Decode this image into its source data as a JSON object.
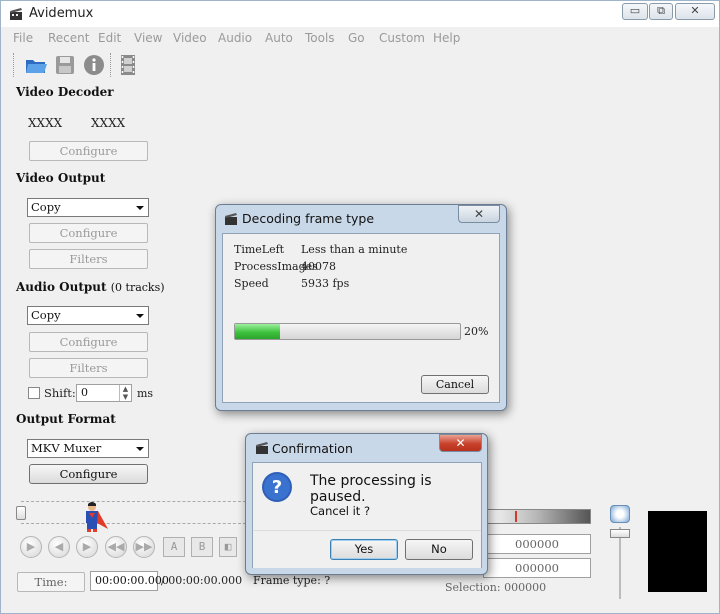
{
  "window": {
    "title": "Avidemux",
    "min_glyph": "▭",
    "max_glyph": "⧉",
    "close_glyph": "✕"
  },
  "menu": [
    "File",
    "Recent",
    "Edit",
    "View",
    "Video",
    "Audio",
    "Auto",
    "Tools",
    "Go",
    "Custom",
    "Help"
  ],
  "toolbar_icons": [
    "open-folder-icon",
    "save-disk-icon",
    "info-icon",
    "filmstrip-icon"
  ],
  "video_decoder": {
    "title": "Video Decoder",
    "codec_a": "XXXX",
    "codec_b": "XXXX",
    "configure_label": "Configure"
  },
  "video_output": {
    "title": "Video Output",
    "selected": "Copy",
    "configure_label": "Configure",
    "filters_label": "Filters"
  },
  "audio_output": {
    "title": "Audio Output",
    "tracks_note": "(0 tracks)",
    "selected": "Copy",
    "configure_label": "Configure",
    "filters_label": "Filters",
    "shift_label": "Shift:",
    "shift_value": "0",
    "shift_unit": "ms"
  },
  "output_format": {
    "title": "Output Format",
    "selected": "MKV Muxer",
    "configure_label": "Configure"
  },
  "bottom": {
    "time_label": "Time:",
    "time_value": "00:00:00.000",
    "duration": "/ 00:00:00.000",
    "frame_type": "Frame type:  ?",
    "selection": "Selection: 000000",
    "marker_a": "000000",
    "marker_b": "000000"
  },
  "decoding_dialog": {
    "title": "Decoding frame type",
    "rows": [
      {
        "label": "TimeLeft",
        "value": "Less than a minute"
      },
      {
        "label": "ProcessImages",
        "value": "40078"
      },
      {
        "label": "Speed",
        "value": "5933 fps"
      }
    ],
    "progress": 0.2,
    "progress_label": "20%",
    "cancel_label": "Cancel"
  },
  "confirm_dialog": {
    "title": "Confirmation",
    "message": "The processing is paused.",
    "question": "Cancel it ?",
    "yes_label": "Yes",
    "no_label": "No",
    "close_glyph": "✕"
  },
  "colors": {
    "accent": "#3a6fc4",
    "progress_green": "#3ec23e"
  }
}
